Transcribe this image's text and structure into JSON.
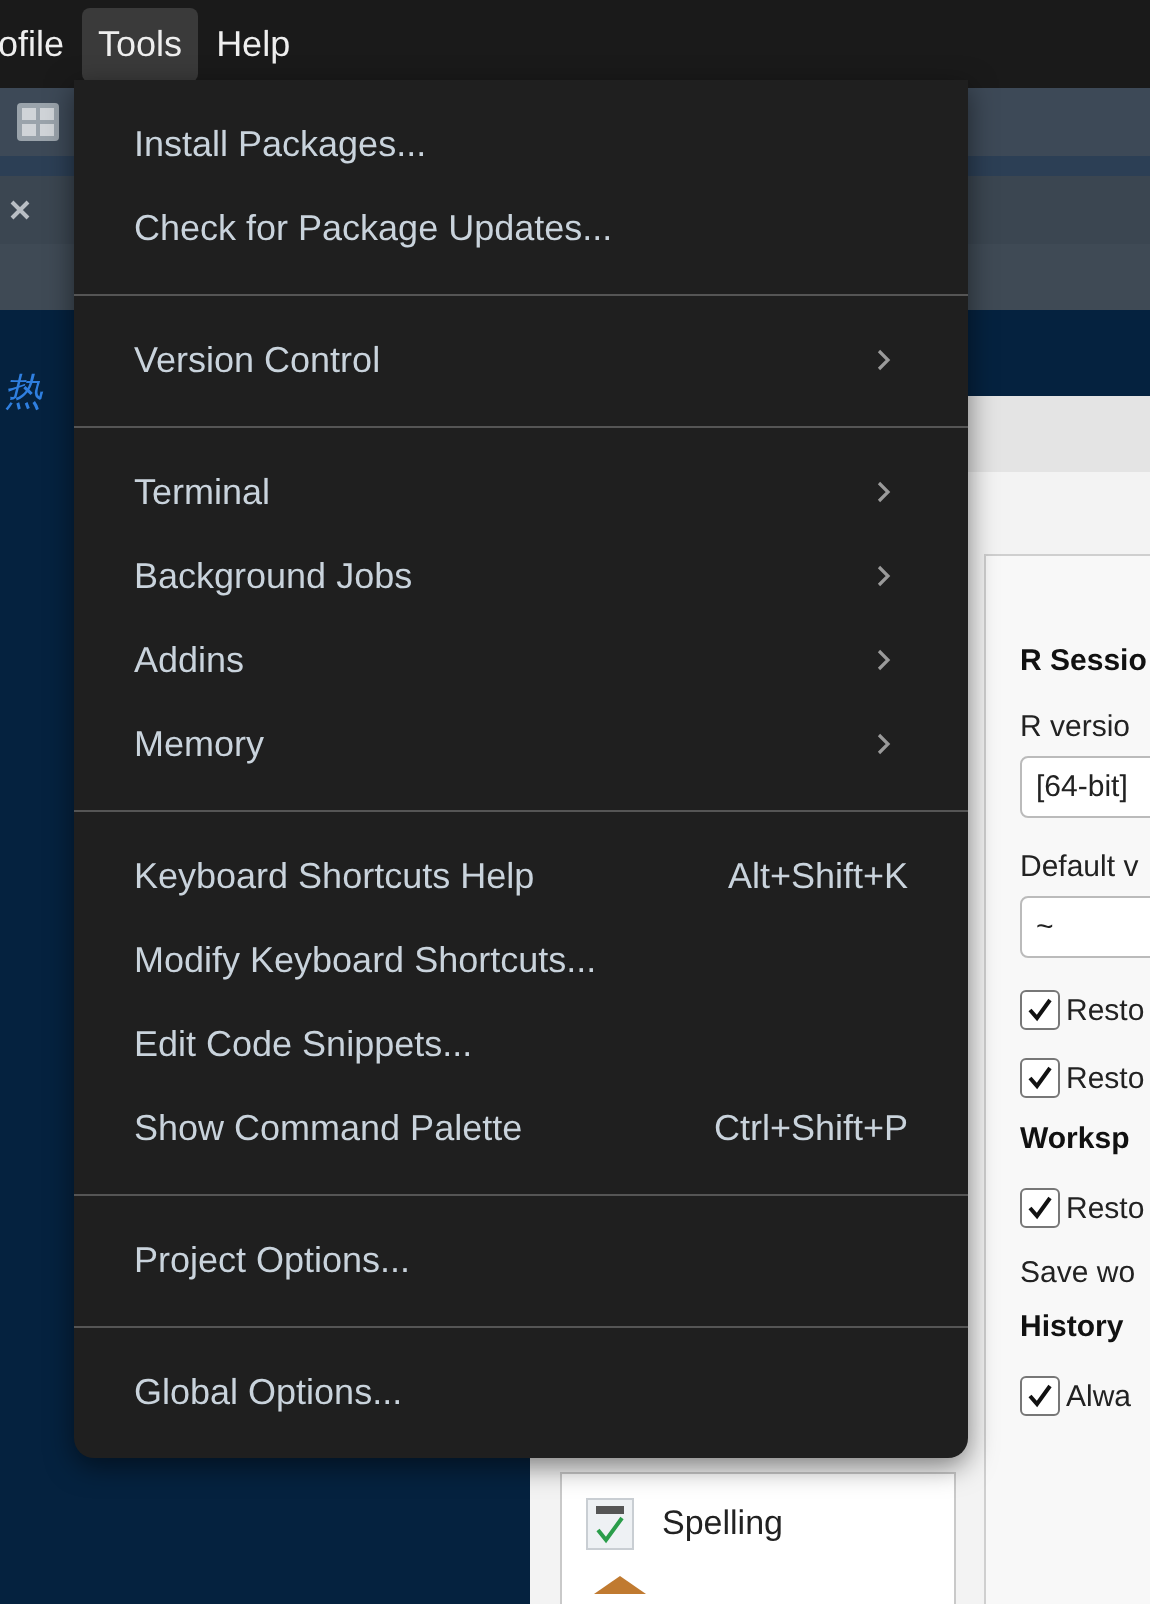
{
  "menubar": [
    {
      "label": "ofile",
      "selected": false
    },
    {
      "label": "Tools",
      "selected": true
    },
    {
      "label": "Help",
      "selected": false
    }
  ],
  "editor": {
    "text": "热"
  },
  "tools_menu": {
    "groups": [
      {
        "items": [
          {
            "label": "Install Packages..."
          },
          {
            "label": "Check for Package Updates..."
          }
        ]
      },
      {
        "items": [
          {
            "label": "Version Control",
            "submenu": true
          }
        ]
      },
      {
        "items": [
          {
            "label": "Terminal",
            "submenu": true
          },
          {
            "label": "Background Jobs",
            "submenu": true
          },
          {
            "label": "Addins",
            "submenu": true
          },
          {
            "label": "Memory",
            "submenu": true
          }
        ]
      },
      {
        "items": [
          {
            "label": "Keyboard Shortcuts Help",
            "shortcut": "Alt+Shift+K"
          },
          {
            "label": "Modify Keyboard Shortcuts..."
          },
          {
            "label": "Edit Code Snippets..."
          },
          {
            "label": "Show Command Palette",
            "shortcut": "Ctrl+Shift+P"
          }
        ]
      },
      {
        "items": [
          {
            "label": "Project Options..."
          }
        ]
      },
      {
        "items": [
          {
            "label": "Global Options..."
          }
        ]
      }
    ]
  },
  "options_dialog": {
    "sidebar_items": [
      {
        "label": "Spelling"
      }
    ],
    "panel": [
      {
        "kind": "heading",
        "text": "R Sessio"
      },
      {
        "kind": "label",
        "text": "R versio"
      },
      {
        "kind": "field",
        "text": "[64-bit]"
      },
      {
        "kind": "label",
        "text": "Default v"
      },
      {
        "kind": "field",
        "text": "~"
      },
      {
        "kind": "checkbox",
        "text": "Resto",
        "checked": true
      },
      {
        "kind": "checkbox",
        "text": "Resto",
        "checked": true
      },
      {
        "kind": "heading",
        "text": "Worksp"
      },
      {
        "kind": "checkbox",
        "text": "Resto",
        "checked": true
      },
      {
        "kind": "label",
        "text": "Save wo"
      },
      {
        "kind": "heading",
        "text": "History"
      },
      {
        "kind": "checkbox",
        "text": "Alwa",
        "checked": true
      }
    ]
  }
}
